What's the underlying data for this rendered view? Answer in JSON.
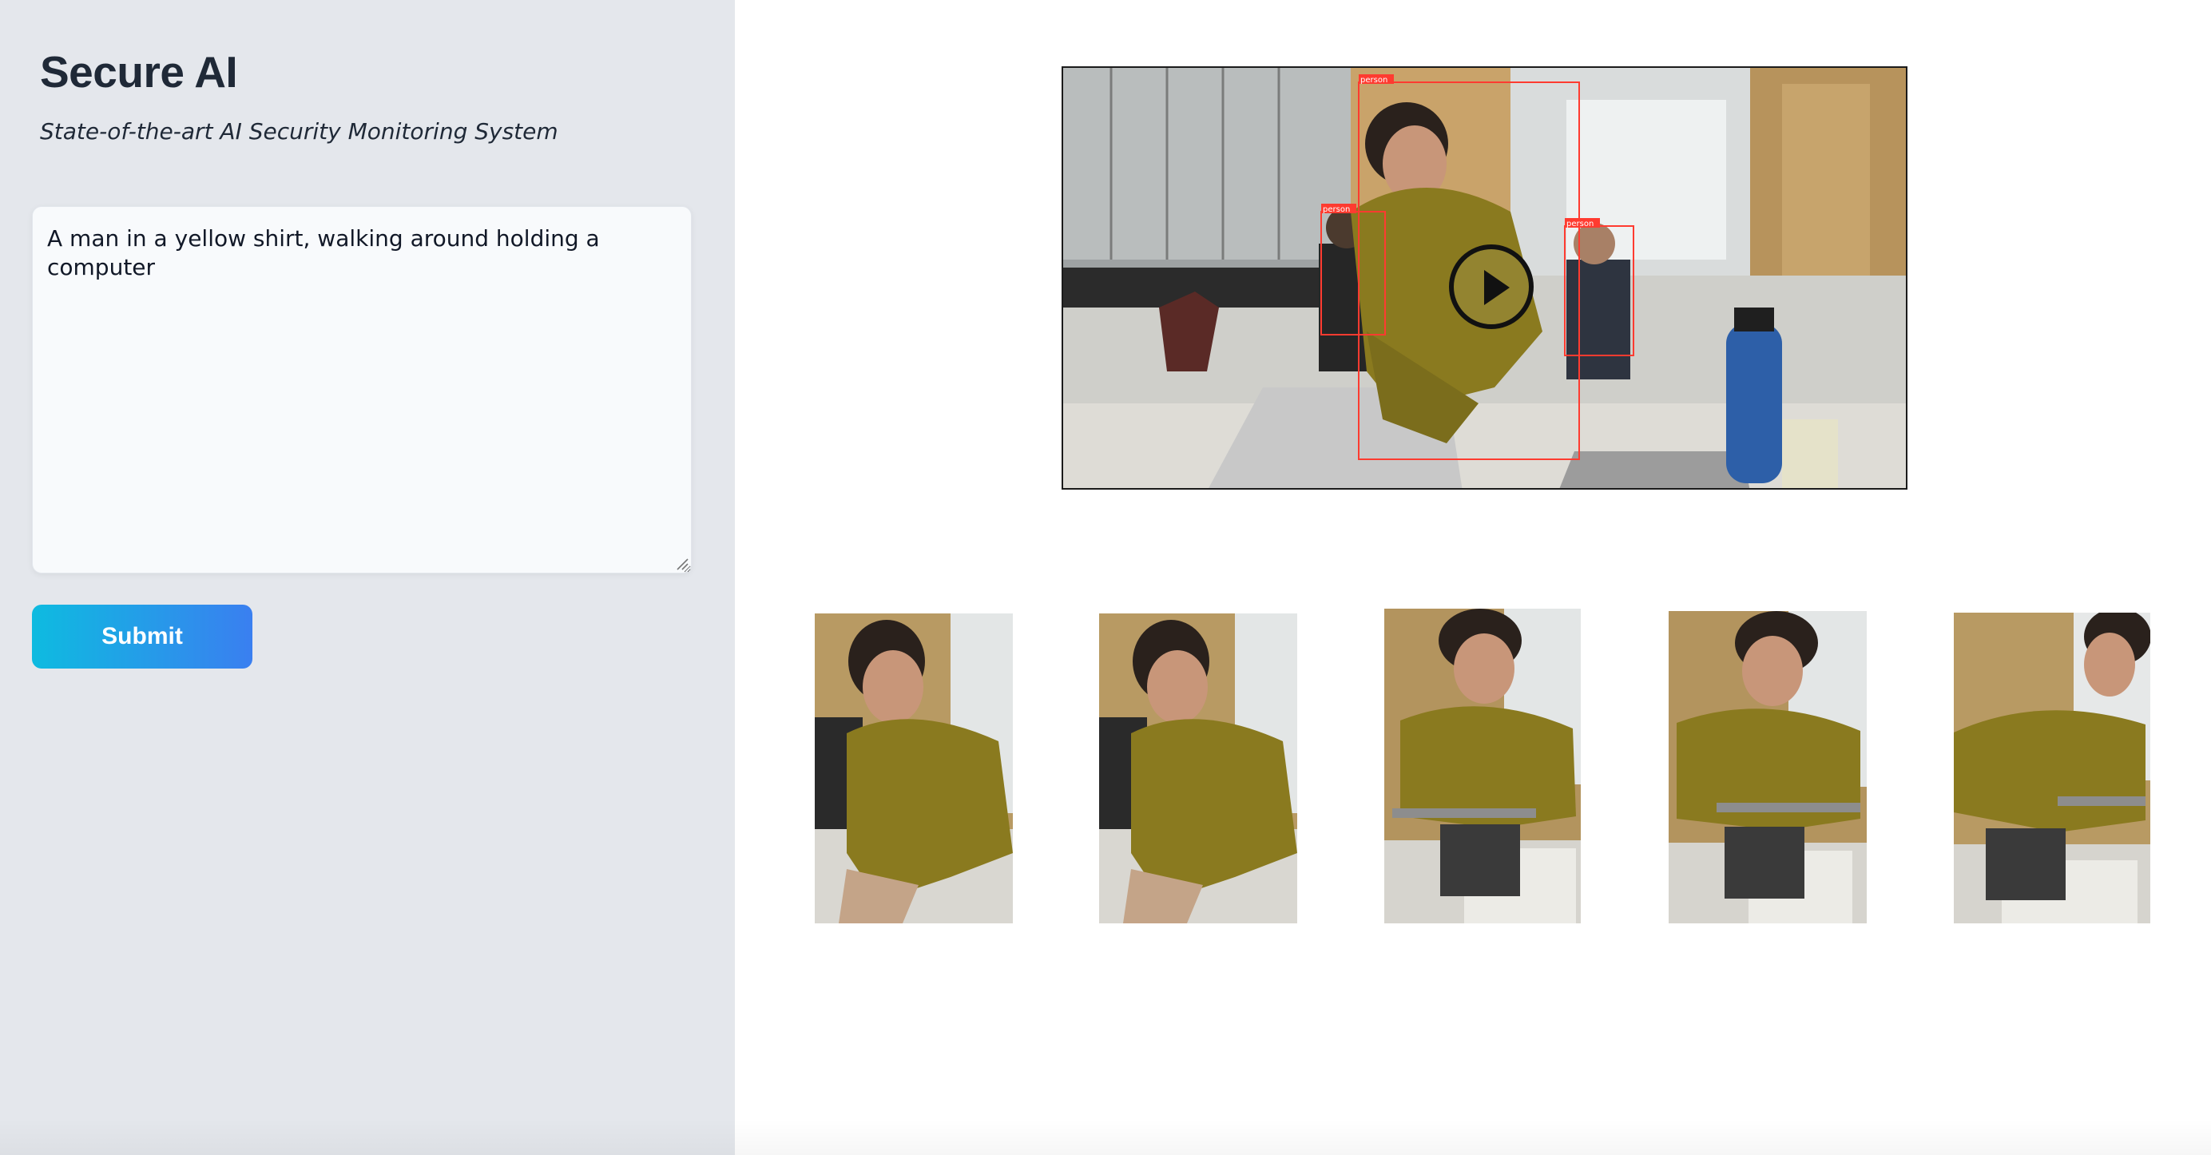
{
  "app": {
    "title": "Secure AI",
    "subtitle": "State-of-the-art AI Security Monitoring System"
  },
  "prompt": {
    "value": "A man in a yellow shirt, walking around holding a computer"
  },
  "submit": {
    "label": "Submit"
  },
  "video": {
    "detections": [
      {
        "label": "person",
        "color": "#ff3b30"
      },
      {
        "label": "person",
        "color": "#ff3b30"
      },
      {
        "label": "person",
        "color": "#ff3b30"
      }
    ]
  },
  "colors": {
    "sidebar_bg": "#e4e7ec",
    "button_gradient_start": "#0ebbe0",
    "button_gradient_end": "#3a7ff0",
    "detection_box": "#ff3b30",
    "shirt": "#8a7a1f"
  },
  "thumbnails": [
    {
      "name": "frame-1"
    },
    {
      "name": "frame-2"
    },
    {
      "name": "frame-3"
    },
    {
      "name": "frame-4"
    },
    {
      "name": "frame-5"
    }
  ]
}
